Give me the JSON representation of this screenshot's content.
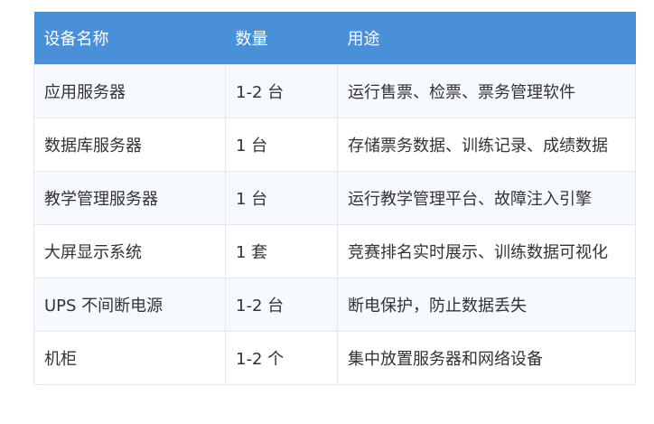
{
  "table": {
    "headers": [
      "设备名称",
      "数量",
      "用途"
    ],
    "rows": [
      [
        "应用服务器",
        "1-2 台",
        "运行售票、检票、票务管理软件"
      ],
      [
        "数据库服务器",
        "1 台",
        "存储票务数据、训练记录、成绩数据"
      ],
      [
        "教学管理服务器",
        "1 台",
        "运行教学管理平台、故障注入引擎"
      ],
      [
        "大屏显示系统",
        "1 套",
        "竞赛排名实时展示、训练数据可视化"
      ],
      [
        "UPS 不间断电源",
        "1-2 台",
        "断电保护，防止数据丢失"
      ],
      [
        "机柜",
        "1-2 个",
        "集中放置服务器和网络设备"
      ]
    ]
  },
  "colors": {
    "header_bg": "#4a90d9",
    "header_text": "#ffffff",
    "row_alt_bg": "#f6f9fd",
    "border": "#e3e8ee"
  }
}
